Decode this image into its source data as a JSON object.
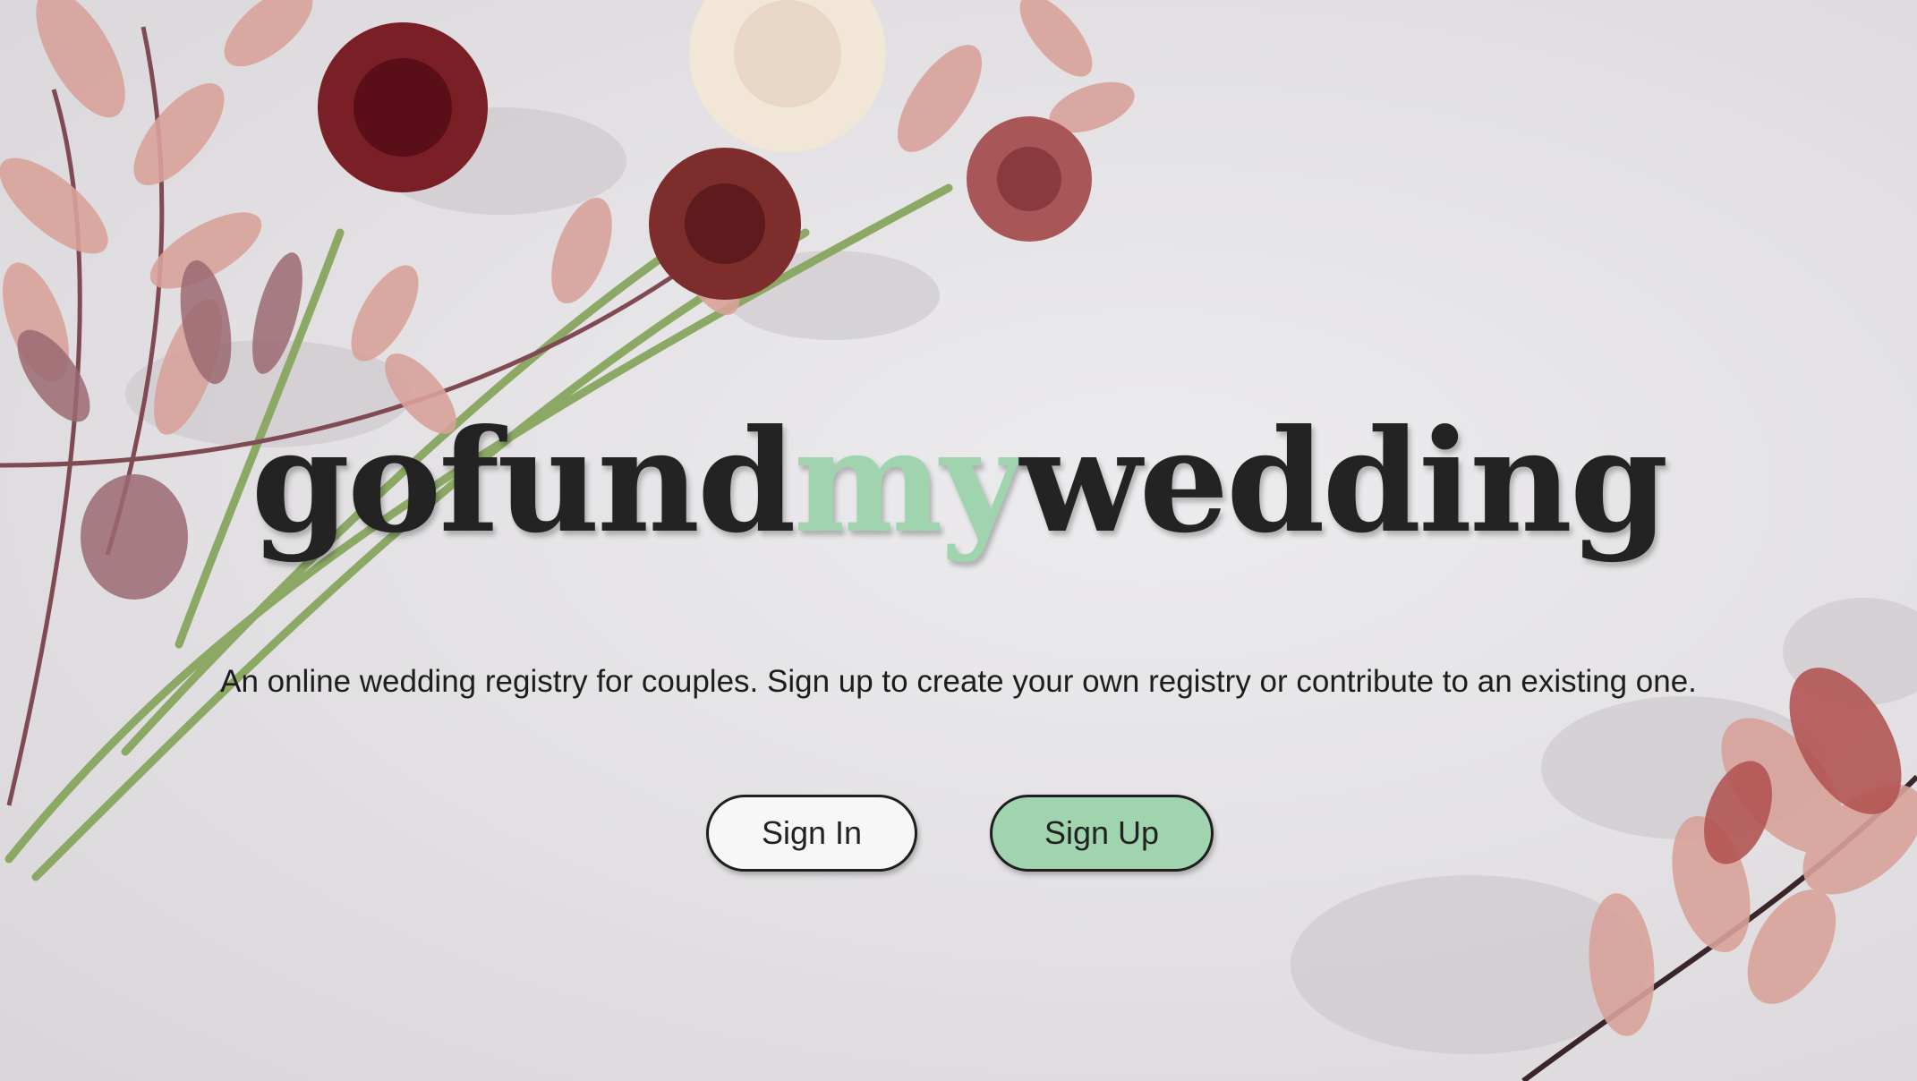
{
  "brand": {
    "part1": "gofund",
    "part2": "my",
    "part3": "wedding",
    "accent_color": "#9fd4ae",
    "text_color": "#232323"
  },
  "tagline": "An online wedding registry for couples. Sign up to create your own registry or contribute to an existing one.",
  "actions": {
    "sign_in_label": "Sign In",
    "sign_up_label": "Sign Up"
  },
  "decor": {
    "background_image": "dried-flowers-icon",
    "leaf_color": "#d9a29a",
    "flower_color": "#7a1f26"
  }
}
